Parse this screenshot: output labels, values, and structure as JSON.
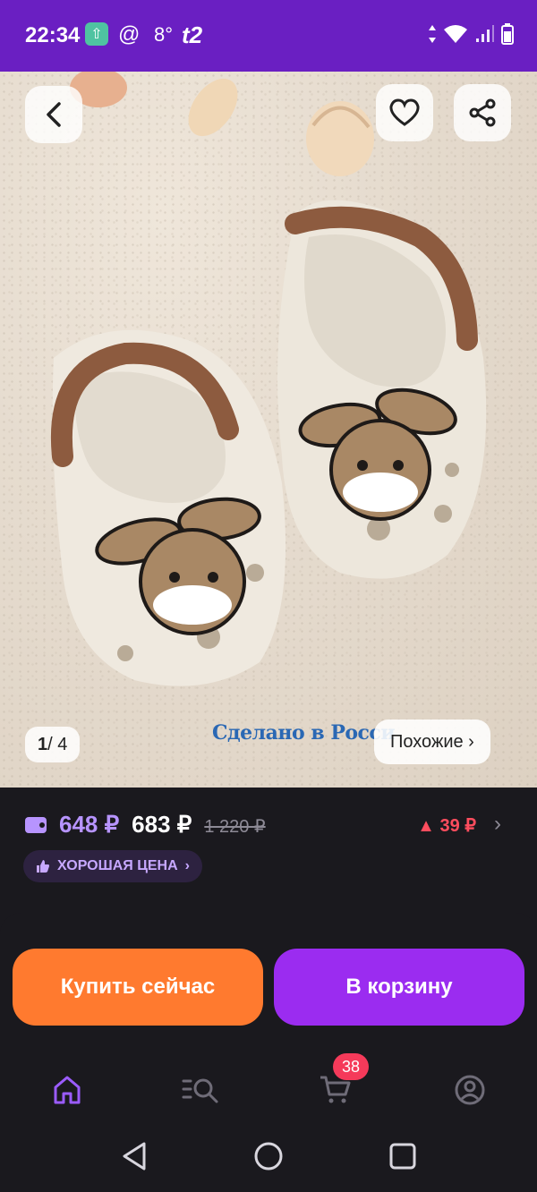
{
  "status_bar": {
    "time": "22:34",
    "temperature": "8°",
    "carrier": "t2",
    "at_symbol": "@"
  },
  "gallery": {
    "current": "1",
    "total": "/ 4",
    "similar_label": "Похожие ›",
    "made_in_text": "Сделано в Росси"
  },
  "price": {
    "wallet_price": "648 ₽",
    "price": "683 ₽",
    "old_price": "1 220 ₽",
    "change": "▲ 39 ₽",
    "good_price_label": "ХОРОШАЯ ЦЕНА",
    "good_price_chevron": "›"
  },
  "actions": {
    "buy_now": "Купить сейчас",
    "add_to_cart": "В корзину"
  },
  "tab_bar": {
    "cart_badge": "38"
  },
  "colors": {
    "status_bar": "#6a1fc2",
    "buy_now": "#ff7a2f",
    "add_to_cart": "#9b2cf0",
    "wallet_price": "#b794ff",
    "price_change": "#ff4d5e",
    "badge": "#f53a5a"
  },
  "icons": [
    "back-icon",
    "heart-icon",
    "share-icon",
    "wallet-icon",
    "thumbs-up-icon",
    "home-icon",
    "catalog-search-icon",
    "cart-icon",
    "profile-icon"
  ]
}
